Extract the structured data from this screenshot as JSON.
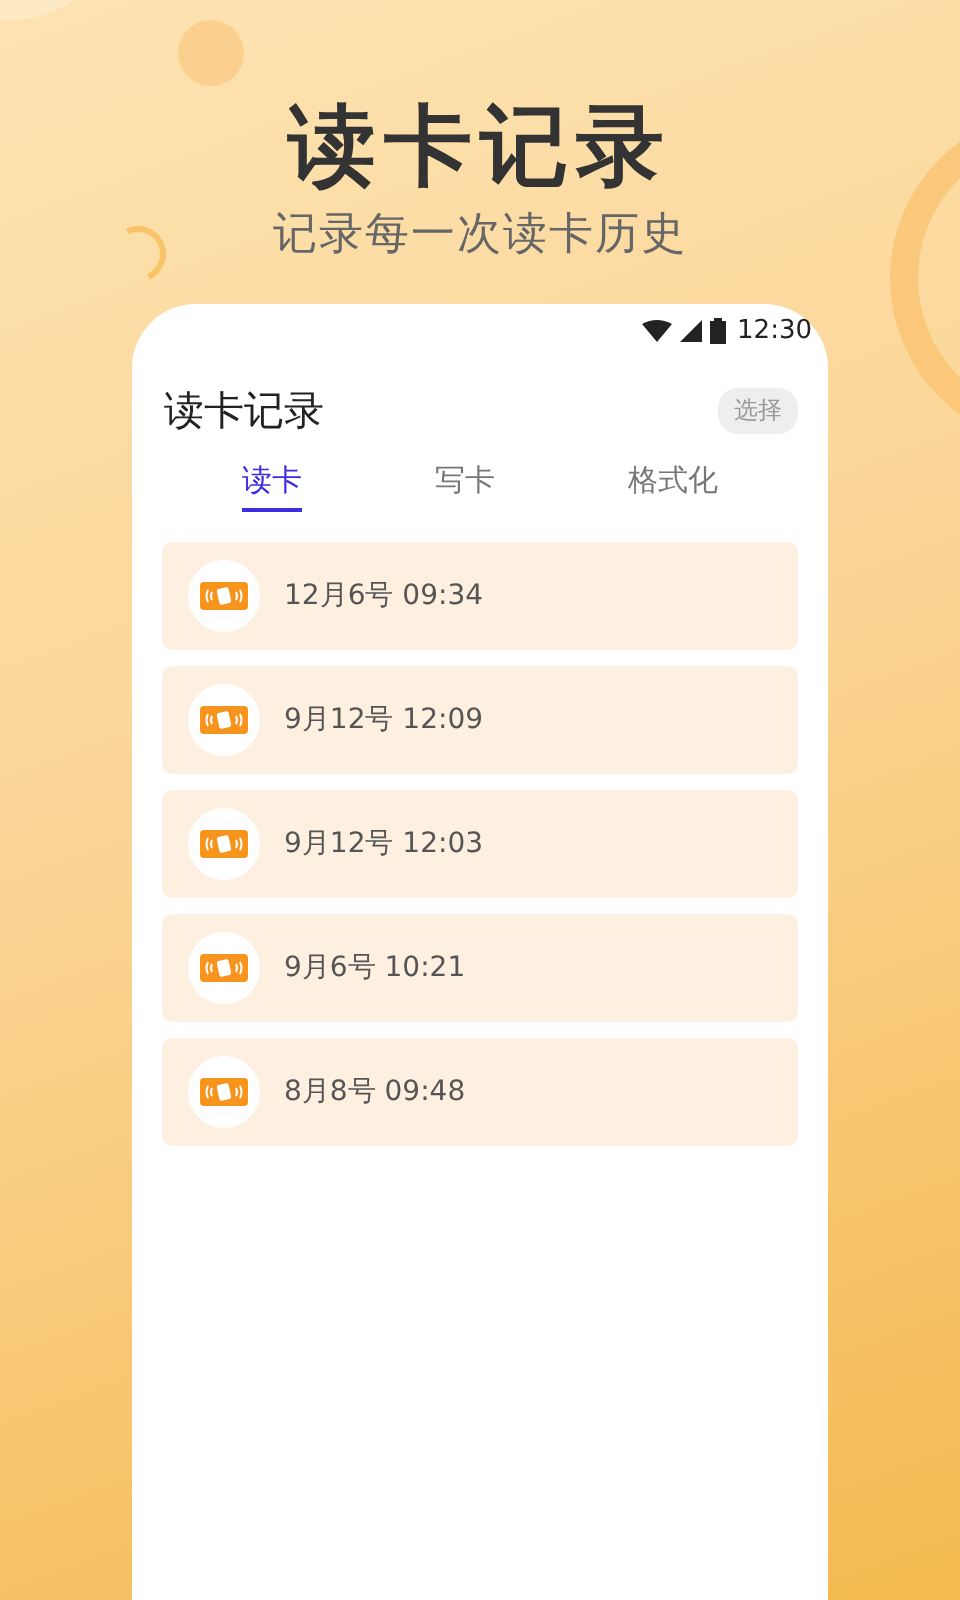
{
  "banner": {
    "title": "读卡记录",
    "subtitle": "记录每一次读卡历史"
  },
  "status_bar": {
    "time": "12:30"
  },
  "header": {
    "title": "读卡记录",
    "action": "选择"
  },
  "tabs": [
    {
      "label": "读卡",
      "selected": true
    },
    {
      "label": "写卡",
      "selected": false
    },
    {
      "label": "格式化",
      "selected": false
    }
  ],
  "records": [
    {
      "time": "12月6号 09:34"
    },
    {
      "time": "9月12号 12:09"
    },
    {
      "time": "9月12号 12:03"
    },
    {
      "time": "9月6号 10:21"
    },
    {
      "time": "8月8号 09:48"
    }
  ]
}
